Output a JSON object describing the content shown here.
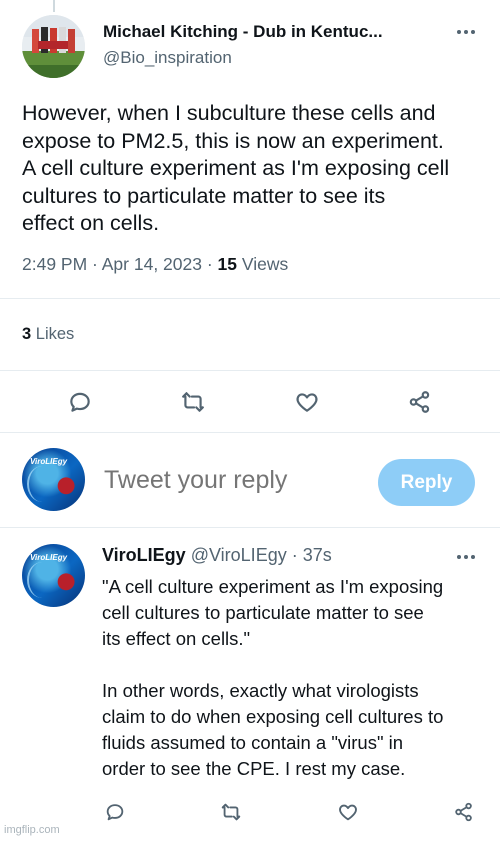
{
  "main_tweet": {
    "author_name": "Michael Kitching - Dub in Kentuc...",
    "author_handle": "@Bio_inspiration",
    "text": "However, when I subculture these cells and\nexpose to PM2.5, this is now an experiment.\nA cell culture experiment as I'm exposing cell\ncultures to particulate matter to see its\neffect on cells.",
    "time": "2:49 PM · Apr 14, 2023 · ",
    "views_count": "15",
    "views_label": " Views",
    "likes_count": "3",
    "likes_label": " Likes",
    "actions": [
      "reply-icon",
      "retweet-icon",
      "like-icon",
      "share-icon"
    ]
  },
  "composer": {
    "avatar_label": "ViroLIEgy",
    "placeholder": "Tweet your reply",
    "reply_button": "Reply",
    "reply_button_color": "#8ecdf7"
  },
  "reply_tweet": {
    "author_name": "ViroLIEgy",
    "author_handle": "@ViroLIEgy",
    "time": " · 37s",
    "text": "\"A cell culture experiment as I'm exposing\ncell cultures to particulate matter to see\nits effect on cells.\"\n\nIn other words, exactly what virologists\nclaim to do when exposing cell cultures to\nfluids assumed to contain a \"virus\" in\norder to see the CPE. I rest my case."
  },
  "watermark": "imgflip.com",
  "colors": {
    "text_primary": "#0f1419",
    "text_secondary": "#536471",
    "divider": "#e6ecf0"
  }
}
